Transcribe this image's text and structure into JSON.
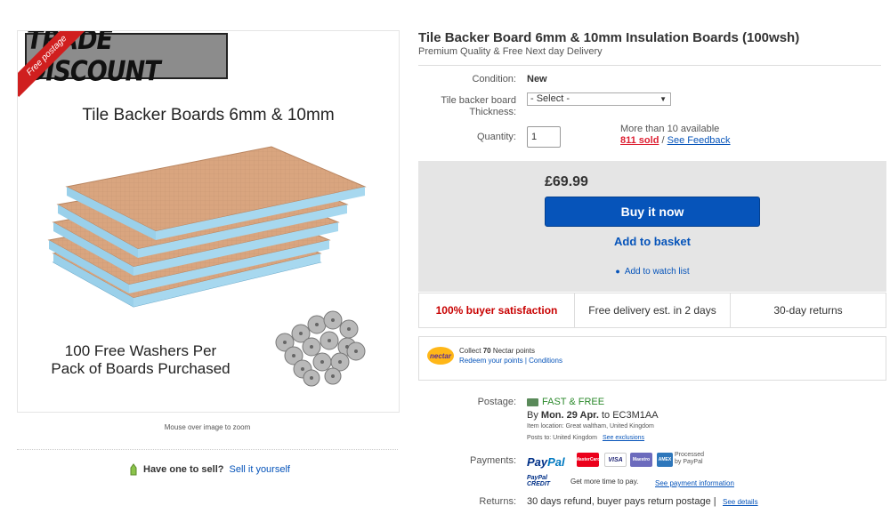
{
  "image": {
    "trade_banner": "TRADE DISCOUNT",
    "ribbon": "Free postage",
    "title": "Tile Backer Boards 6mm & 10mm",
    "washers_line1": "100 Free Washers Per",
    "washers_line2": "Pack of Boards Purchased",
    "mouse_over": "Mouse over image to zoom"
  },
  "sell": {
    "question": "Have one to sell?",
    "link": "Sell it yourself"
  },
  "product": {
    "title": "Tile Backer Board 6mm & 10mm Insulation Boards (100wsh)",
    "subtitle": "Premium Quality & Free Next day Delivery"
  },
  "condition": {
    "label": "Condition:",
    "value": "New"
  },
  "thickness": {
    "label_line1": "Tile backer board",
    "label_line2": "Thickness:",
    "selected": "- Select -"
  },
  "quantity": {
    "label": "Quantity:",
    "value": "1",
    "available": "More than 10 available",
    "sold": "811 sold",
    "separator": "/",
    "feedback": "See Feedback"
  },
  "purchase": {
    "price": "£69.99",
    "buy_now": "Buy it now",
    "add_basket": "Add to basket",
    "watch": "Add to watch list"
  },
  "features": [
    "100% buyer satisfaction",
    "Free delivery est. in 2 days",
    "30-day returns"
  ],
  "nectar": {
    "logo": "nectar",
    "collect_prefix": "Collect",
    "points": "70",
    "collect_suffix": "Nectar points",
    "redeem": "Redeem your points",
    "sep": "|",
    "conditions": "Conditions"
  },
  "postage": {
    "label": "Postage:",
    "value": "FAST & FREE",
    "by_prefix": "By",
    "date": "Mon. 29 Apr.",
    "to": "to EC3M1AA",
    "item_location": "Item location:  Great waltham, United Kingdom",
    "posts_to": "Posts to:  United Kingdom",
    "exclusions": "See exclusions"
  },
  "payments": {
    "label": "Payments:",
    "paypal_a": "Pay",
    "paypal_b": "Pal",
    "cards": [
      "MasterCard",
      "VISA",
      "Maestro",
      "AMEX"
    ],
    "processed_line1": "Processed",
    "processed_line2": "by PayPal",
    "credit_logo_line1": "PayPal",
    "credit_logo_line2": "CREDIT",
    "credit_text": "Get more time to pay.",
    "credit_link": "See payment information"
  },
  "returns": {
    "label": "Returns:",
    "value": "30 days refund, buyer pays return postage |",
    "link": "See details"
  }
}
